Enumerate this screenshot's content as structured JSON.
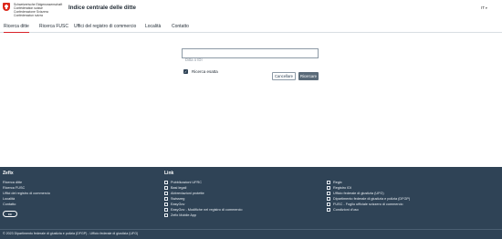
{
  "header": {
    "confederation_lines": [
      "Schweizerische Eidgenossenschaft",
      "Confédération suisse",
      "Confederazione Svizzera",
      "Confederaziun svizra"
    ],
    "app_title": "Indice centrale delle ditte",
    "language": "IT"
  },
  "tabs": [
    {
      "label": "Ricerca ditte"
    },
    {
      "label": "Ricerca FUSC"
    },
    {
      "label": "Uffici del registro di commercio"
    },
    {
      "label": "Località"
    },
    {
      "label": "Contatto"
    }
  ],
  "search": {
    "value": "",
    "placeholder": "Ditta o IDI",
    "exact_label": "Ricerca esatta",
    "exact_checked": true,
    "clear_label": "Cancellare",
    "search_label": "Ricercare"
  },
  "footer": {
    "zefix_heading": "Zefix",
    "zefix_links": [
      "Ricerca ditte",
      "Ricerca FUSC",
      "Uffici del registro di commercio",
      "Località",
      "Contatto"
    ],
    "cc_label": "cc",
    "link_heading": "Link",
    "links_col1": [
      "Pubblicazioni UFRC",
      "Basi legali",
      "Abbreviazioni protette",
      "Swissreg",
      "EasyGov",
      "EasyGov - Modifiche nel registro di commercio",
      "Zefix Mobile App"
    ],
    "links_col2": [
      "Regix",
      "Registro IDI",
      "Ufficio federale di giustizia (UFG)",
      "Dipartimento federale di giustizia e polizia (DFGP)",
      "FUSC - Foglio ufficiale svizzero di commercio",
      "Condizioni d'uso"
    ],
    "copyright": "© 2023 Dipartimento federale di giustizia e polizia (DFGP) - Ufficio federale di giustizia (UFG)"
  },
  "colors": {
    "accent_red": "#d8232a",
    "footer_bg": "#2f4356",
    "primary_button": "#5a6a78"
  }
}
